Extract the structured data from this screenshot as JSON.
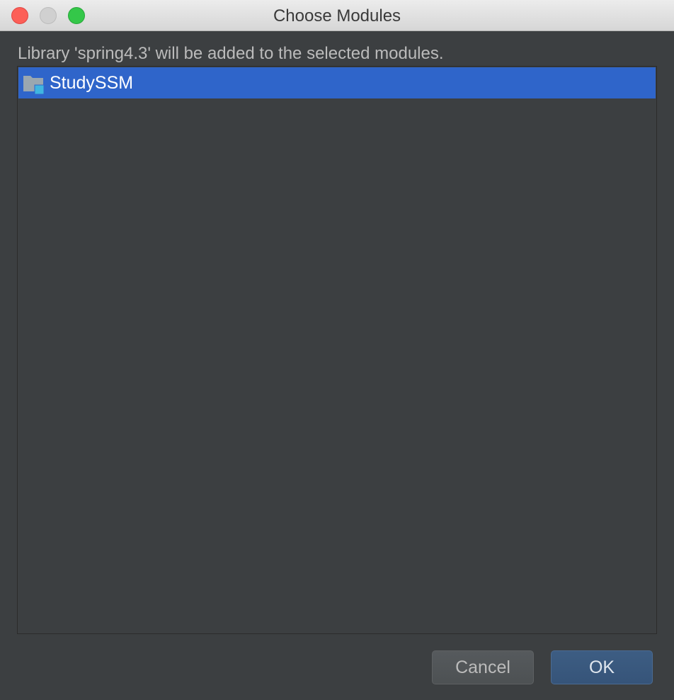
{
  "window": {
    "title": "Choose Modules"
  },
  "dialog": {
    "description": "Library 'spring4.3' will be added to the selected modules.",
    "modules": [
      {
        "label": "StudySSM",
        "icon": "module-folder-icon",
        "selected": true
      }
    ],
    "buttons": {
      "cancel_label": "Cancel",
      "ok_label": "OK"
    }
  },
  "colors": {
    "background": "#3c3f41",
    "selection": "#2f65ca",
    "default_button": "#365479",
    "text": "#bbbbbb"
  }
}
